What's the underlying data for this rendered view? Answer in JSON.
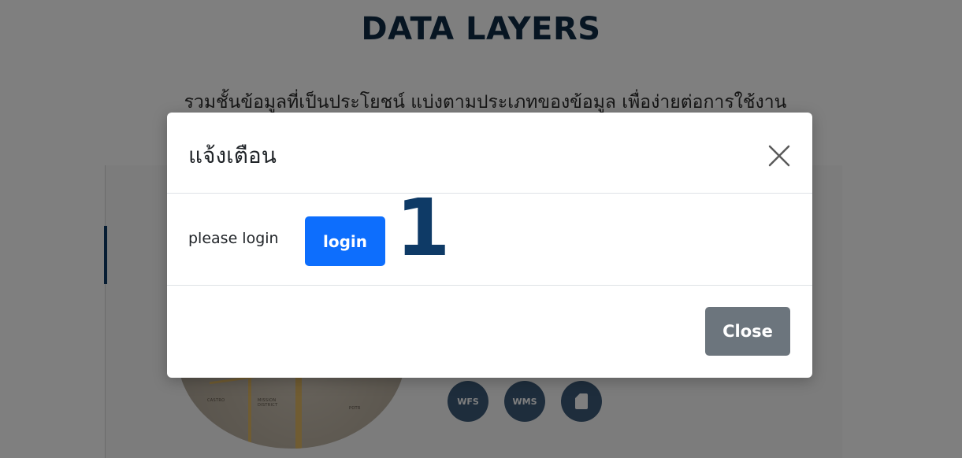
{
  "page": {
    "title": "DATA LAYERS",
    "subtitle": "รวมชั้นข้อมูลที่เป็นประโยชน์ แบ่งตามประเภทของข้อมูล เพื่อง่ายต่อการใช้งาน"
  },
  "map": {
    "labels": [
      "CASTRO",
      "MISSION DISTRICT",
      "POTR"
    ]
  },
  "badges": [
    {
      "label": "WFS",
      "icon": ""
    },
    {
      "label": "WMS",
      "icon": ""
    },
    {
      "label": "",
      "icon": "document-icon"
    }
  ],
  "modal": {
    "title": "แจ้งเตือน",
    "close_icon": "close-icon",
    "body_text": "please login",
    "login_label": "login",
    "step_number": "1",
    "close_label": "Close"
  },
  "colors": {
    "primary": "#0d6efd",
    "secondary": "#6c757d",
    "navy": "#0e3a66"
  }
}
